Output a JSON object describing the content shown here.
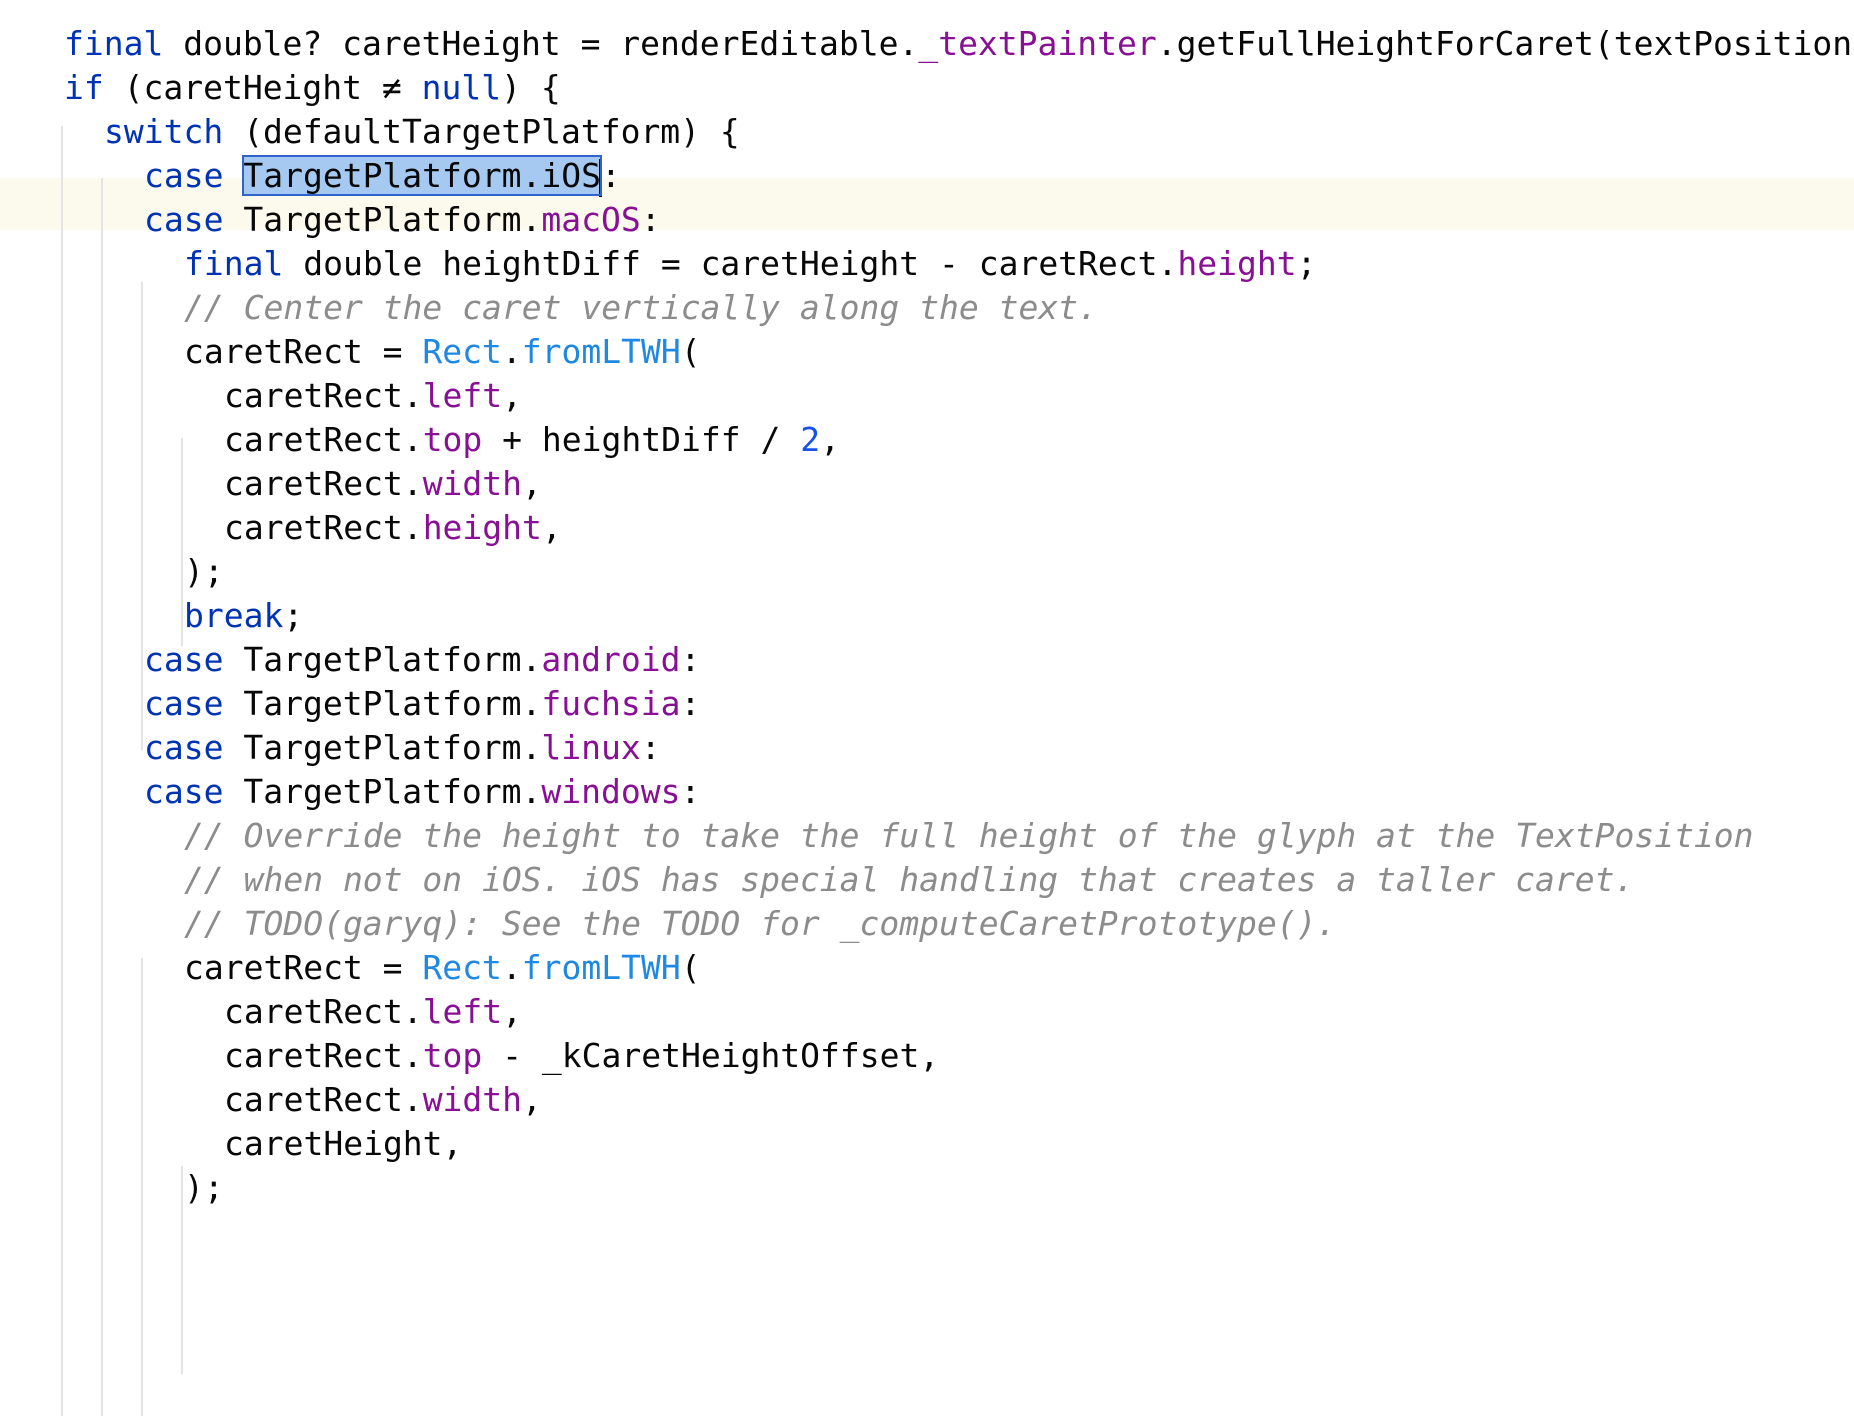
{
  "colors": {
    "keyword": "#0033b3",
    "property": "#871094",
    "class": "#1f88e0",
    "number": "#1750eb",
    "comment": "#8c8c8c",
    "text": "#080808",
    "selection": "#a6c9f2",
    "current_line": "#fcfaed"
  },
  "lines": [
    {
      "tokens": [
        {
          "t": "final",
          "c": "kw"
        },
        {
          "t": " double? caretHeight = renderEditable."
        },
        {
          "t": "_textPainter",
          "c": "prop"
        },
        {
          "t": ".getFullHeightForCaret(textPosition"
        }
      ]
    },
    {
      "tokens": [
        {
          "t": "if",
          "c": "kw"
        },
        {
          "t": " (caretHeight ≠ "
        },
        {
          "t": "null",
          "c": "kw"
        },
        {
          "t": ") {"
        }
      ]
    },
    {
      "tokens": [
        {
          "t": "switch",
          "c": "kw"
        },
        {
          "t": " (defaultTargetPlatform) {"
        }
      ]
    },
    {
      "tokens": [
        {
          "t": "case",
          "c": "kw"
        },
        {
          "t": " "
        },
        {
          "t": "TargetPlatform.iOS",
          "c": "sel"
        },
        {
          "t": "",
          "c": "caret"
        },
        {
          "t": ":"
        }
      ]
    },
    {
      "tokens": [
        {
          "t": "case",
          "c": "kw"
        },
        {
          "t": " TargetPlatform."
        },
        {
          "t": "macOS",
          "c": "prop"
        },
        {
          "t": ":"
        }
      ]
    },
    {
      "tokens": [
        {
          "t": "final",
          "c": "kw"
        },
        {
          "t": " double heightDiff = caretHeight - caretRect."
        },
        {
          "t": "height",
          "c": "prop"
        },
        {
          "t": ";"
        }
      ]
    },
    {
      "tokens": [
        {
          "t": "// Center the caret vertically along the text.",
          "c": "cmt"
        }
      ]
    },
    {
      "tokens": [
        {
          "t": "caretRect = "
        },
        {
          "t": "Rect",
          "c": "cls"
        },
        {
          "t": "."
        },
        {
          "t": "fromLTWH",
          "c": "cls"
        },
        {
          "t": "("
        }
      ]
    },
    {
      "tokens": [
        {
          "t": "caretRect."
        },
        {
          "t": "left",
          "c": "prop"
        },
        {
          "t": ","
        }
      ]
    },
    {
      "tokens": [
        {
          "t": "caretRect."
        },
        {
          "t": "top",
          "c": "prop"
        },
        {
          "t": " + heightDiff / "
        },
        {
          "t": "2",
          "c": "num"
        },
        {
          "t": ","
        }
      ]
    },
    {
      "tokens": [
        {
          "t": "caretRect."
        },
        {
          "t": "width",
          "c": "prop"
        },
        {
          "t": ","
        }
      ]
    },
    {
      "tokens": [
        {
          "t": "caretRect."
        },
        {
          "t": "height",
          "c": "prop"
        },
        {
          "t": ","
        }
      ]
    },
    {
      "tokens": [
        {
          "t": ");"
        }
      ]
    },
    {
      "tokens": [
        {
          "t": "break",
          "c": "kw"
        },
        {
          "t": ";"
        }
      ]
    },
    {
      "tokens": [
        {
          "t": "case",
          "c": "kw"
        },
        {
          "t": " TargetPlatform."
        },
        {
          "t": "android",
          "c": "prop"
        },
        {
          "t": ":"
        }
      ]
    },
    {
      "tokens": [
        {
          "t": "case",
          "c": "kw"
        },
        {
          "t": " TargetPlatform."
        },
        {
          "t": "fuchsia",
          "c": "prop"
        },
        {
          "t": ":"
        }
      ]
    },
    {
      "tokens": [
        {
          "t": "case",
          "c": "kw"
        },
        {
          "t": " TargetPlatform."
        },
        {
          "t": "linux",
          "c": "prop"
        },
        {
          "t": ":"
        }
      ]
    },
    {
      "tokens": [
        {
          "t": "case",
          "c": "kw"
        },
        {
          "t": " TargetPlatform."
        },
        {
          "t": "windows",
          "c": "prop"
        },
        {
          "t": ":"
        }
      ]
    },
    {
      "tokens": [
        {
          "t": "// Override the height to take the full height of the glyph at the TextPosition",
          "c": "cmt"
        }
      ]
    },
    {
      "tokens": [
        {
          "t": "// when not on iOS. iOS has special handling that creates a taller caret.",
          "c": "cmt"
        }
      ]
    },
    {
      "tokens": [
        {
          "t": "// TODO(garyq): See the TODO for _computeCaretPrototype().",
          "c": "cmt"
        }
      ]
    },
    {
      "tokens": [
        {
          "t": "caretRect = "
        },
        {
          "t": "Rect",
          "c": "cls"
        },
        {
          "t": "."
        },
        {
          "t": "fromLTWH",
          "c": "cls"
        },
        {
          "t": "("
        }
      ]
    },
    {
      "tokens": [
        {
          "t": "caretRect."
        },
        {
          "t": "left",
          "c": "prop"
        },
        {
          "t": ","
        }
      ]
    },
    {
      "tokens": [
        {
          "t": "caretRect."
        },
        {
          "t": "top",
          "c": "prop"
        },
        {
          "t": " - _kCaretHeightOffset,"
        }
      ]
    },
    {
      "tokens": [
        {
          "t": "caretRect."
        },
        {
          "t": "width",
          "c": "prop"
        },
        {
          "t": ","
        }
      ]
    },
    {
      "tokens": [
        {
          "t": "caretHeight,"
        }
      ]
    },
    {
      "tokens": [
        {
          "t": ");"
        }
      ]
    }
  ]
}
